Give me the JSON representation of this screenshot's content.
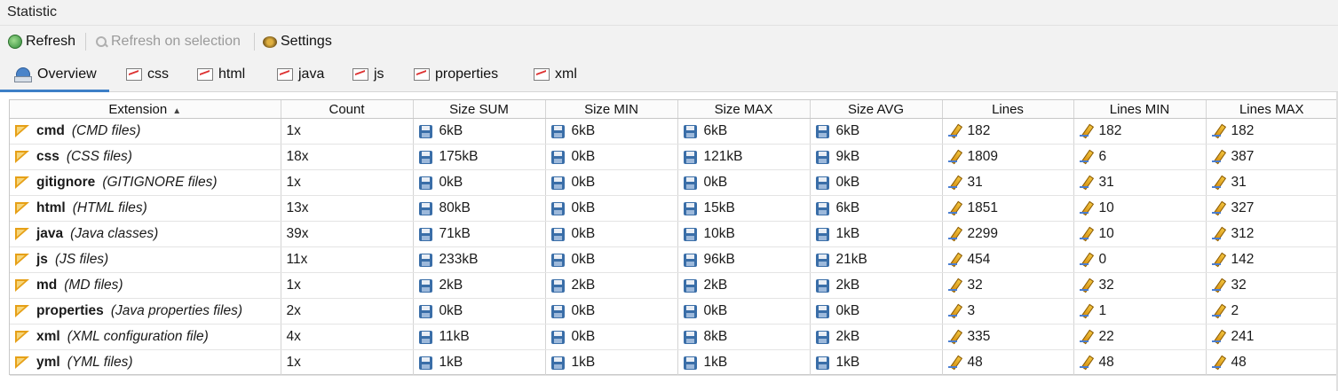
{
  "window": {
    "title": "Statistic"
  },
  "toolbar": {
    "refresh_label": "Refresh",
    "refresh_selection_label": "Refresh on selection",
    "settings_label": "Settings"
  },
  "tabs": [
    {
      "label": "Overview",
      "icon": "overview-icon",
      "active": true
    },
    {
      "label": "css",
      "icon": "chart-icon"
    },
    {
      "label": "html",
      "icon": "chart-icon"
    },
    {
      "label": "java",
      "icon": "chart-icon"
    },
    {
      "label": "js",
      "icon": "chart-icon"
    },
    {
      "label": "properties",
      "icon": "chart-icon"
    },
    {
      "label": "xml",
      "icon": "chart-icon"
    }
  ],
  "table": {
    "columns": [
      "Extension",
      "Count",
      "Size SUM",
      "Size MIN",
      "Size MAX",
      "Size AVG",
      "Lines",
      "Lines MIN",
      "Lines MAX"
    ],
    "sort_column": "Extension",
    "sort_direction": "ascending",
    "rows": [
      {
        "ext": "cmd",
        "desc": "(CMD files)",
        "count": "1x",
        "size_sum": "6kB",
        "size_min": "6kB",
        "size_max": "6kB",
        "size_avg": "6kB",
        "lines": "182",
        "lines_min": "182",
        "lines_max": "182"
      },
      {
        "ext": "css",
        "desc": "(CSS files)",
        "count": "18x",
        "size_sum": "175kB",
        "size_min": "0kB",
        "size_max": "121kB",
        "size_avg": "9kB",
        "lines": "1809",
        "lines_min": "6",
        "lines_max": "387"
      },
      {
        "ext": "gitignore",
        "desc": "(GITIGNORE files)",
        "count": "1x",
        "size_sum": "0kB",
        "size_min": "0kB",
        "size_max": "0kB",
        "size_avg": "0kB",
        "lines": "31",
        "lines_min": "31",
        "lines_max": "31"
      },
      {
        "ext": "html",
        "desc": "(HTML files)",
        "count": "13x",
        "size_sum": "80kB",
        "size_min": "0kB",
        "size_max": "15kB",
        "size_avg": "6kB",
        "lines": "1851",
        "lines_min": "10",
        "lines_max": "327"
      },
      {
        "ext": "java",
        "desc": "(Java classes)",
        "count": "39x",
        "size_sum": "71kB",
        "size_min": "0kB",
        "size_max": "10kB",
        "size_avg": "1kB",
        "lines": "2299",
        "lines_min": "10",
        "lines_max": "312"
      },
      {
        "ext": "js",
        "desc": "(JS files)",
        "count": "11x",
        "size_sum": "233kB",
        "size_min": "0kB",
        "size_max": "96kB",
        "size_avg": "21kB",
        "lines": "454",
        "lines_min": "0",
        "lines_max": "142"
      },
      {
        "ext": "md",
        "desc": "(MD files)",
        "count": "1x",
        "size_sum": "2kB",
        "size_min": "2kB",
        "size_max": "2kB",
        "size_avg": "2kB",
        "lines": "32",
        "lines_min": "32",
        "lines_max": "32"
      },
      {
        "ext": "properties",
        "desc": "(Java properties files)",
        "count": "2x",
        "size_sum": "0kB",
        "size_min": "0kB",
        "size_max": "0kB",
        "size_avg": "0kB",
        "lines": "3",
        "lines_min": "1",
        "lines_max": "2"
      },
      {
        "ext": "xml",
        "desc": "(XML configuration file)",
        "count": "4x",
        "size_sum": "11kB",
        "size_min": "0kB",
        "size_max": "8kB",
        "size_avg": "2kB",
        "lines": "335",
        "lines_min": "22",
        "lines_max": "241"
      },
      {
        "ext": "yml",
        "desc": "(YML files)",
        "count": "1x",
        "size_sum": "1kB",
        "size_min": "1kB",
        "size_max": "1kB",
        "size_avg": "1kB",
        "lines": "48",
        "lines_min": "48",
        "lines_max": "48"
      }
    ]
  }
}
